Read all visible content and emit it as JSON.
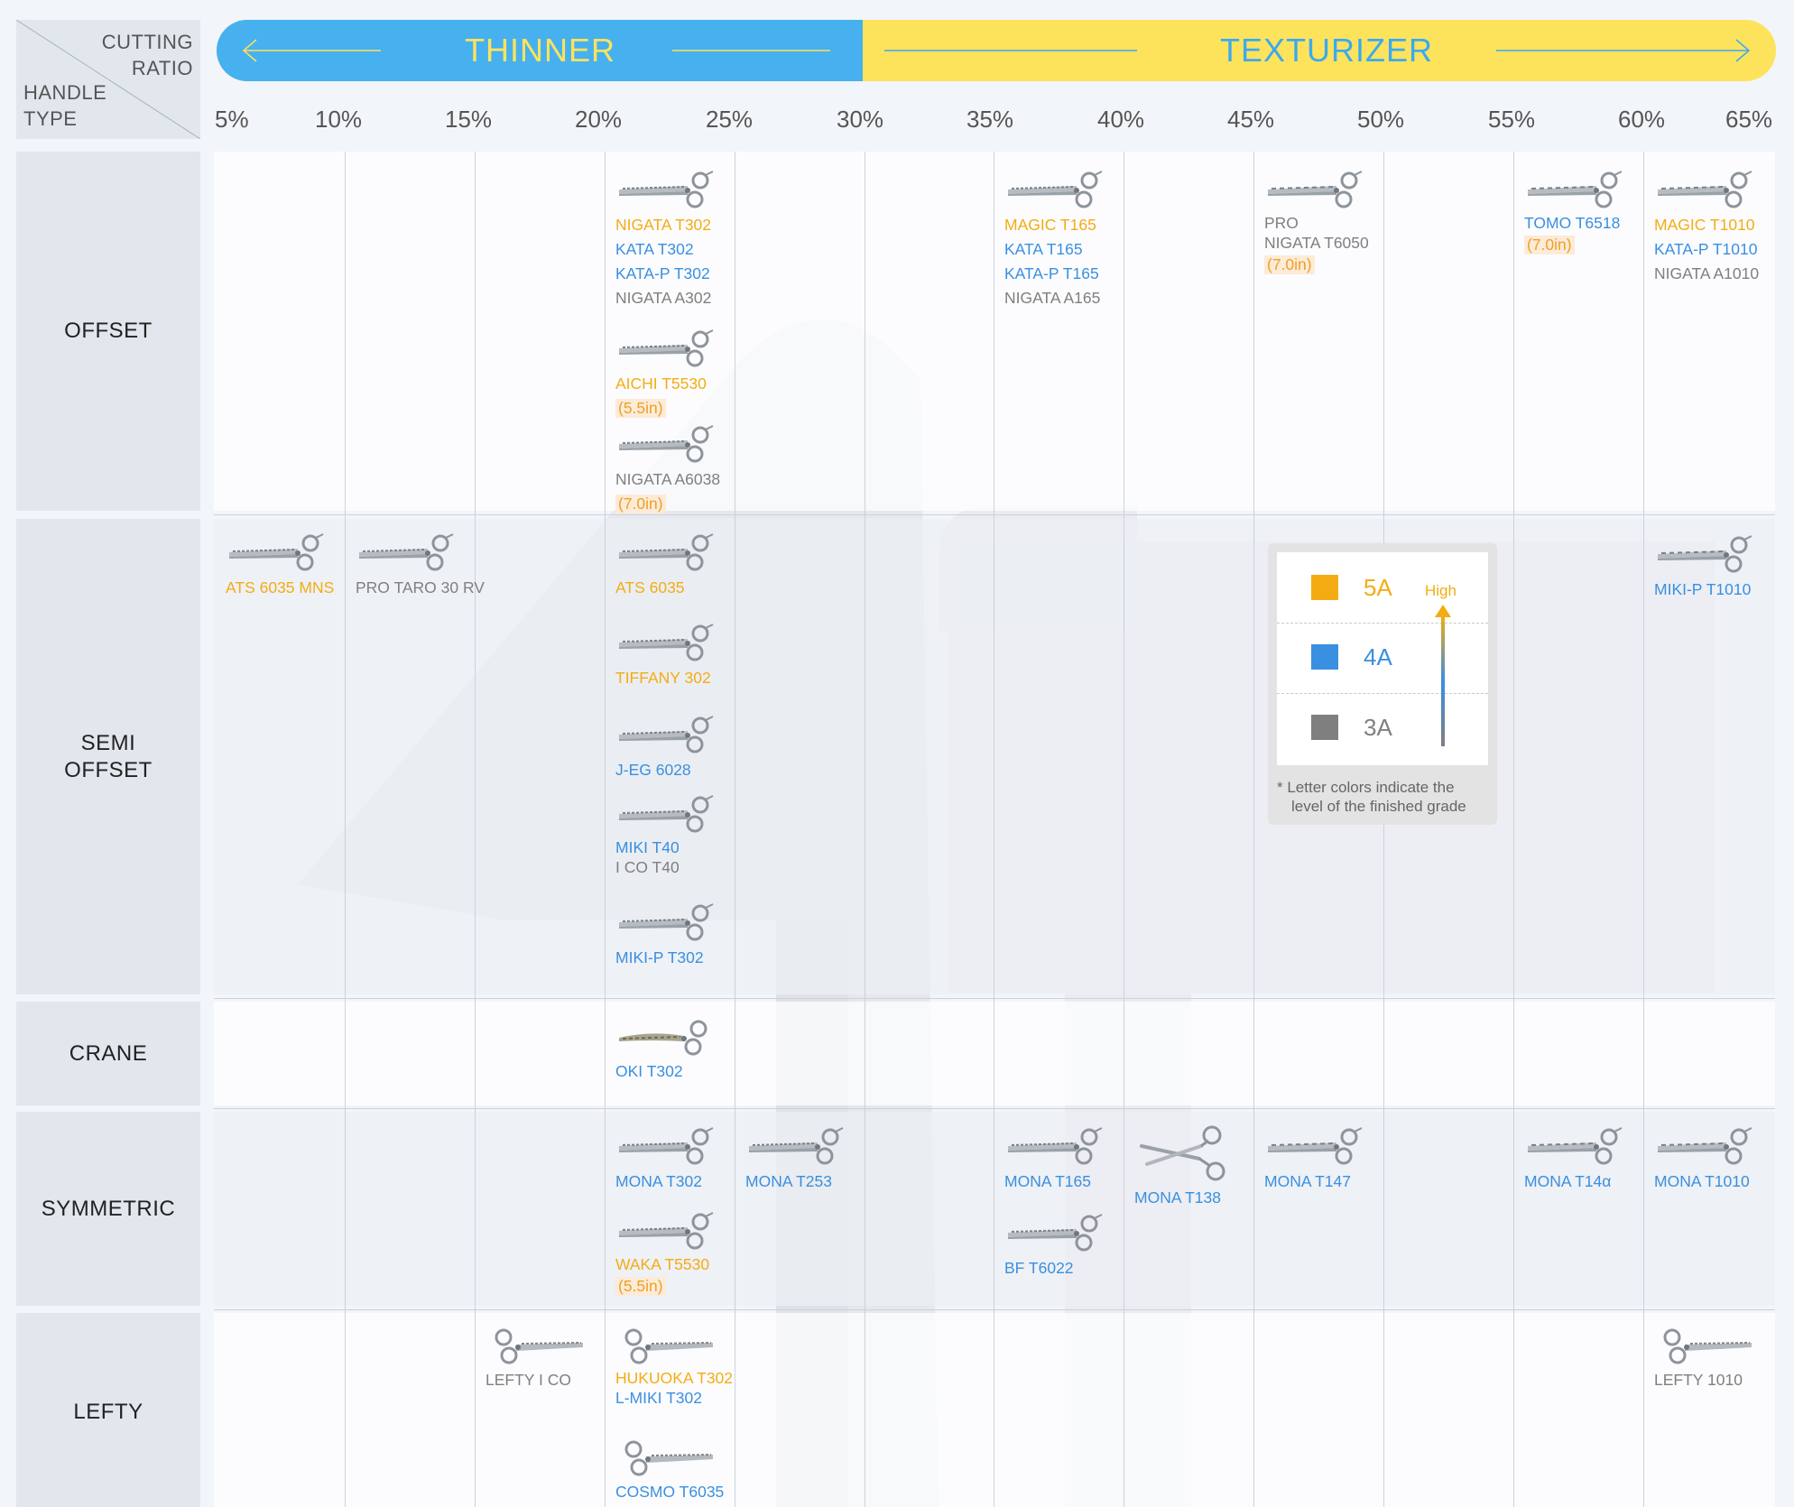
{
  "colors": {
    "grade_5a": "#f4ac14",
    "grade_4a": "#3a8fe0",
    "grade_3a": "#7f7f7f",
    "thinner": "#47b0ef",
    "texturizer": "#fde35c"
  },
  "corner": {
    "cutting_ratio_line1": "CUTTING",
    "cutting_ratio_line2": "RATIO",
    "handle_type_line1": "HANDLE",
    "handle_type_line2": "TYPE"
  },
  "banner": {
    "thinner": "THINNER",
    "texturizer": "TEXTURIZER",
    "left_arrow_icon": "arrow-left-icon",
    "right_arrow_icon": "arrow-right-icon"
  },
  "ratios": [
    "5%",
    "10%",
    "15%",
    "20%",
    "25%",
    "30%",
    "35%",
    "40%",
    "45%",
    "50%",
    "55%",
    "60%",
    "65%"
  ],
  "rows": [
    {
      "label": [
        "OFFSET"
      ]
    },
    {
      "label": [
        "SEMI",
        "OFFSET"
      ]
    },
    {
      "label": [
        "CRANE"
      ]
    },
    {
      "label": [
        "SYMMETRIC"
      ]
    },
    {
      "label": [
        "LEFTY"
      ]
    }
  ],
  "products": [
    {
      "row": 0,
      "col": 3,
      "slot": 0,
      "icon": "thinning-shears-icon",
      "lines": [
        {
          "t": "NIGATA T302",
          "g": "5A"
        },
        {
          "t": "KATA T302",
          "g": "4A"
        },
        {
          "t": "KATA-P T302",
          "g": "4A"
        },
        {
          "t": "NIGATA A302",
          "g": "3A"
        }
      ]
    },
    {
      "row": 0,
      "col": 3,
      "slot": 1,
      "icon": "thinning-shears-icon",
      "lines": [
        {
          "t": "AICHI T5530",
          "g": "5A"
        },
        {
          "t": "(5.5in)",
          "g": "5A",
          "size": true
        }
      ]
    },
    {
      "row": 0,
      "col": 3,
      "slot": 2,
      "icon": "thinning-shears-icon",
      "lines": [
        {
          "t": "NIGATA A6038",
          "g": "3A"
        },
        {
          "t": "(7.0in)",
          "g": "5A",
          "size": true
        }
      ]
    },
    {
      "row": 0,
      "col": 6,
      "slot": 0,
      "icon": "thinning-shears-icon",
      "lines": [
        {
          "t": "MAGIC T165",
          "g": "5A"
        },
        {
          "t": "KATA T165",
          "g": "4A"
        },
        {
          "t": "KATA-P T165",
          "g": "4A"
        },
        {
          "t": "NIGATA A165",
          "g": "3A"
        }
      ]
    },
    {
      "row": 0,
      "col": 8,
      "slot": 0,
      "icon": "texturizing-shears-icon",
      "lines": [
        {
          "t": "PRO",
          "g": "3A",
          "sub": true
        },
        {
          "t": "NIGATA T6050",
          "g": "3A",
          "sub": true
        },
        {
          "t": "(7.0in)",
          "g": "5A",
          "size": true
        }
      ]
    },
    {
      "row": 0,
      "col": 10,
      "slot": 0,
      "icon": "texturizing-shears-icon",
      "lines": [
        {
          "t": "TOMO T6518",
          "g": "4A",
          "sub": true
        },
        {
          "t": "(7.0in)",
          "g": "5A",
          "size": true
        }
      ]
    },
    {
      "row": 0,
      "col": 11,
      "slot": 0,
      "icon": "texturizing-shears-icon",
      "lines": [
        {
          "t": "MAGIC T1010",
          "g": "5A"
        },
        {
          "t": "KATA-P T1010",
          "g": "4A"
        },
        {
          "t": "NIGATA A1010",
          "g": "3A"
        }
      ]
    },
    {
      "row": 1,
      "col": 0,
      "slot": 0,
      "icon": "thinning-shears-icon",
      "lines": [
        {
          "t": "ATS 6035 MNS",
          "g": "5A"
        }
      ]
    },
    {
      "row": 1,
      "col": 1,
      "slot": 0,
      "icon": "thinning-shears-icon",
      "lines": [
        {
          "t": "PRO TARO 30 RV",
          "g": "3A"
        }
      ]
    },
    {
      "row": 1,
      "col": 3,
      "slot": 0,
      "icon": "thinning-shears-icon",
      "lines": [
        {
          "t": "ATS 6035",
          "g": "5A"
        }
      ]
    },
    {
      "row": 1,
      "col": 3,
      "slot": 1,
      "icon": "thinning-shears-icon",
      "lines": [
        {
          "t": "TIFFANY 302",
          "g": "5A"
        }
      ]
    },
    {
      "row": 1,
      "col": 3,
      "slot": 2,
      "icon": "thinning-shears-icon",
      "lines": [
        {
          "t": "J-EG 6028",
          "g": "4A"
        }
      ]
    },
    {
      "row": 1,
      "col": 3,
      "slot": 3,
      "icon": "thinning-shears-icon",
      "lines": [
        {
          "t": "MIKI T40",
          "g": "4A",
          "sub": true
        },
        {
          "t": "I CO T40",
          "g": "3A",
          "sub": true
        }
      ]
    },
    {
      "row": 1,
      "col": 3,
      "slot": 4,
      "icon": "thinning-shears-icon",
      "lines": [
        {
          "t": "MIKI-P T302",
          "g": "4A"
        }
      ]
    },
    {
      "row": 1,
      "col": 11,
      "slot": 0,
      "icon": "texturizing-shears-icon",
      "lines": [
        {
          "t": "MIKI-P T1010",
          "g": "4A"
        }
      ]
    },
    {
      "row": 2,
      "col": 3,
      "slot": 0,
      "icon": "crane-shears-icon",
      "lines": [
        {
          "t": "OKI T302",
          "g": "4A"
        }
      ]
    },
    {
      "row": 3,
      "col": 3,
      "slot": 0,
      "icon": "thinning-shears-icon",
      "lines": [
        {
          "t": "MONA T302",
          "g": "4A"
        }
      ]
    },
    {
      "row": 3,
      "col": 3,
      "slot": 1,
      "icon": "thinning-shears-icon",
      "lines": [
        {
          "t": "WAKA T5530",
          "g": "5A",
          "sub": true
        },
        {
          "t": "(5.5in)",
          "g": "5A",
          "size": true
        }
      ]
    },
    {
      "row": 3,
      "col": 4,
      "slot": 0,
      "icon": "thinning-shears-icon",
      "lines": [
        {
          "t": "MONA T253",
          "g": "4A"
        }
      ]
    },
    {
      "row": 3,
      "col": 6,
      "slot": 0,
      "icon": "thinning-shears-icon",
      "lines": [
        {
          "t": "MONA T165",
          "g": "4A"
        }
      ]
    },
    {
      "row": 3,
      "col": 6,
      "slot": 1,
      "icon": "thinning-shears-icon",
      "lines": [
        {
          "t": "BF T6022",
          "g": "4A"
        }
      ]
    },
    {
      "row": 3,
      "col": 7,
      "slot": 0,
      "icon": "open-shears-icon",
      "lines": [
        {
          "t": "MONA T138",
          "g": "4A"
        }
      ]
    },
    {
      "row": 3,
      "col": 8,
      "slot": 0,
      "icon": "texturizing-shears-icon",
      "lines": [
        {
          "t": "MONA T147",
          "g": "4A"
        }
      ]
    },
    {
      "row": 3,
      "col": 10,
      "slot": 0,
      "icon": "texturizing-shears-icon",
      "lines": [
        {
          "t": "MONA T14α",
          "g": "4A"
        }
      ]
    },
    {
      "row": 3,
      "col": 11,
      "slot": 0,
      "icon": "texturizing-shears-icon",
      "lines": [
        {
          "t": "MONA T1010",
          "g": "4A"
        }
      ]
    },
    {
      "row": 4,
      "col": 2,
      "slot": 0,
      "icon": "lefty-shears-icon",
      "lines": [
        {
          "t": "LEFTY I CO",
          "g": "3A"
        }
      ]
    },
    {
      "row": 4,
      "col": 3,
      "slot": 0,
      "icon": "lefty-shears-icon",
      "lines": [
        {
          "t": "HUKUOKA T302",
          "g": "5A",
          "sub": true
        },
        {
          "t": "L-MIKI T302",
          "g": "4A",
          "sub": true
        }
      ]
    },
    {
      "row": 4,
      "col": 3,
      "slot": 1,
      "icon": "lefty-shears-icon",
      "lines": [
        {
          "t": "COSMO T6035",
          "g": "4A"
        }
      ]
    },
    {
      "row": 4,
      "col": 11,
      "slot": 0,
      "icon": "lefty-shears-icon",
      "lines": [
        {
          "t": "LEFTY 1010",
          "g": "3A"
        }
      ]
    }
  ],
  "legend": {
    "grades": [
      {
        "label": "5A",
        "key": "grade_5a"
      },
      {
        "label": "4A",
        "key": "grade_4a"
      },
      {
        "label": "3A",
        "key": "grade_3a"
      }
    ],
    "high": "High",
    "note_line1": "* Letter colors indicate the",
    "note_line2": "level of the finished grade"
  }
}
